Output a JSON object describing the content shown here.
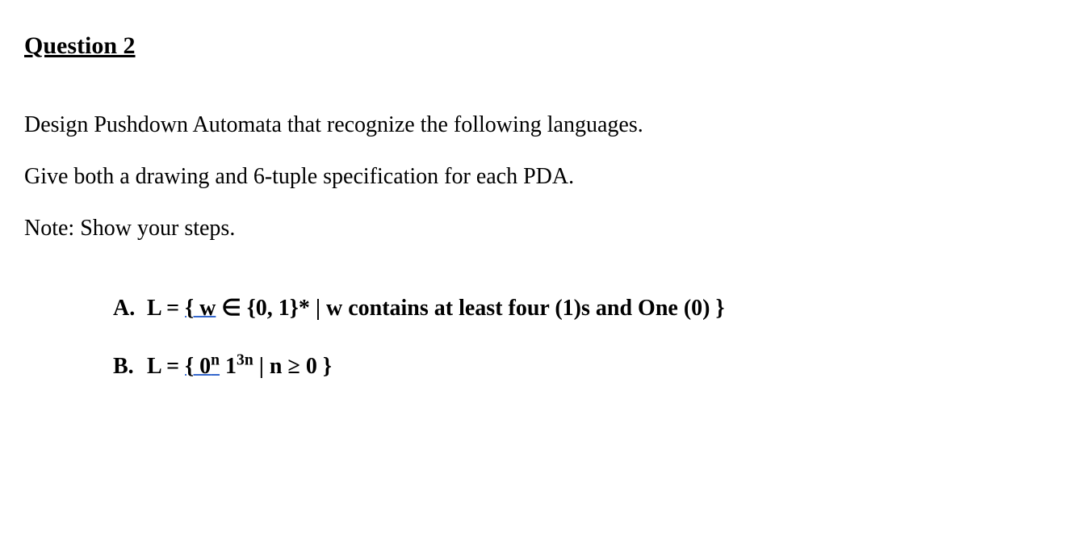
{
  "heading": "Question 2",
  "instructions": {
    "line1": "Design Pushdown Automata that recognize the following languages.",
    "line2": "Give both a drawing and 6-tuple specification for each PDA.",
    "line3": "Note: Show your steps."
  },
  "items": {
    "A": {
      "label": "A.",
      "prefix": "L = ",
      "underlined": "{ w",
      "rest": " ∈ {0, 1}* | w contains at least four (1)s and One (0) }"
    },
    "B": {
      "label": "B.",
      "prefix": "L = ",
      "underlined_pre": "{ 0",
      "sup1": "n",
      "mid": " 1",
      "sup2": "3n",
      "rest": " | n ≥ 0 }"
    }
  }
}
